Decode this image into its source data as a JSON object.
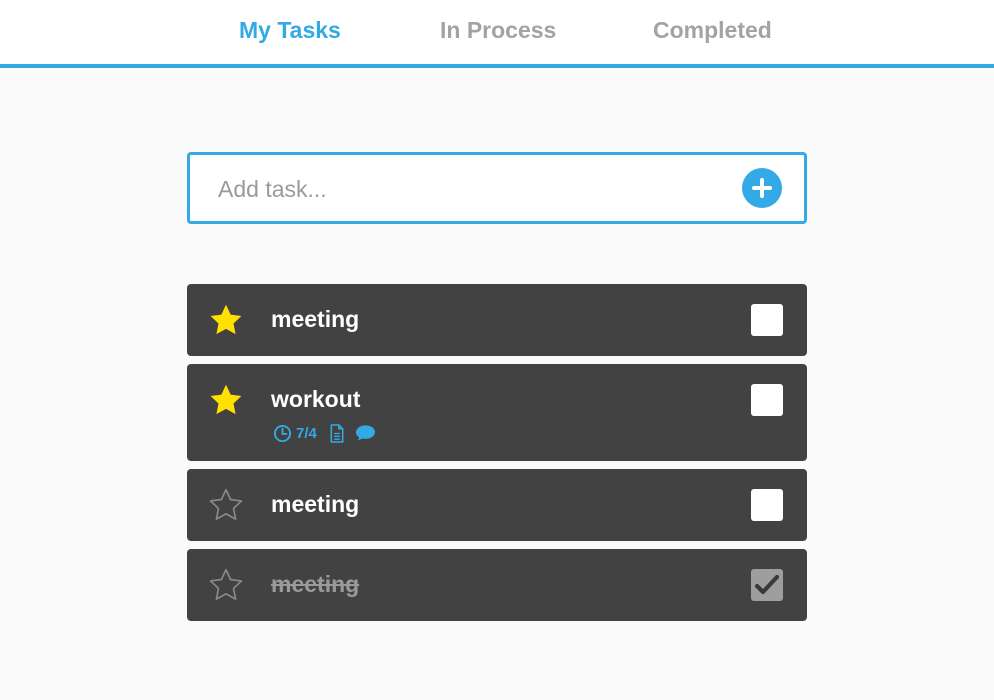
{
  "tabs": [
    {
      "label": "My Tasks",
      "active": true
    },
    {
      "label": "In Process",
      "active": false
    },
    {
      "label": "Completed",
      "active": false
    }
  ],
  "add_task": {
    "placeholder": "Add task...",
    "value": ""
  },
  "tasks": [
    {
      "title": "meeting",
      "starred": true,
      "completed": false
    },
    {
      "title": "workout",
      "starred": true,
      "completed": false,
      "meta": {
        "date": "7/4",
        "icons": [
          "clock-icon",
          "file-icon",
          "comment-icon"
        ]
      }
    },
    {
      "title": "meeting",
      "starred": false,
      "completed": false
    },
    {
      "title": "meeting",
      "starred": false,
      "completed": true
    }
  ],
  "colors": {
    "accent": "#33a9e6",
    "task_bg": "#424242",
    "star": "#ffe100",
    "page_bg": "#fafafa"
  }
}
